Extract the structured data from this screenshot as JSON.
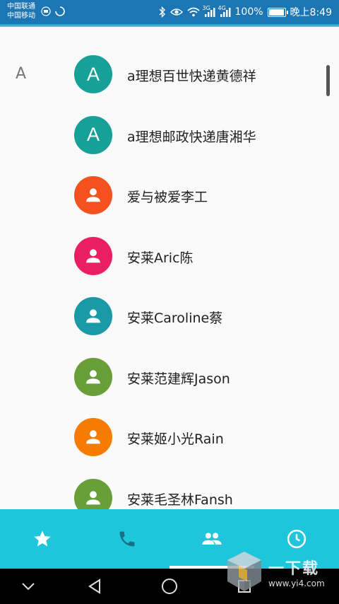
{
  "status_bar": {
    "carrier_1": "中国联通",
    "carrier_2": "中国移动",
    "battery": "100%",
    "battery_level": 1.0,
    "time": "晚上8:49",
    "net_3g": "3G",
    "net_4g": "4G"
  },
  "contacts": {
    "section_letter": "A",
    "items": [
      {
        "name": "a理想百世快递黄德祥",
        "avatar": "A",
        "color": "#17a097"
      },
      {
        "name": "a理想邮政快递唐湘华",
        "avatar": "A",
        "color": "#17a097"
      },
      {
        "name": "爱与被爱李工",
        "avatar": "",
        "color": "#f4511e"
      },
      {
        "name": "安莱Aric陈",
        "avatar": "",
        "color": "#e91e63"
      },
      {
        "name": "安莱Caroline蔡",
        "avatar": "",
        "color": "#1a9aa6"
      },
      {
        "name": "安莱范建辉Jason",
        "avatar": "",
        "color": "#689f38"
      },
      {
        "name": "安莱姬小光Rain",
        "avatar": "",
        "color": "#f57c00"
      },
      {
        "name": "安莱毛圣林Fansh",
        "avatar": "",
        "color": "#689f38"
      }
    ]
  },
  "tabs": [
    {
      "icon": "star-icon",
      "label": "favorites"
    },
    {
      "icon": "phone-icon",
      "label": "calls"
    },
    {
      "icon": "contacts-icon",
      "label": "contacts"
    },
    {
      "icon": "clock-icon",
      "label": "recents"
    }
  ],
  "active_tab": 2,
  "watermark": {
    "text": "一下载",
    "url": "www.yi4.com"
  },
  "colors": {
    "status_bar": "#1d76b4",
    "tab_bar": "#1fc5da",
    "nav_bar": "#000000",
    "tab_icon_inactive": "#1a6f86"
  }
}
